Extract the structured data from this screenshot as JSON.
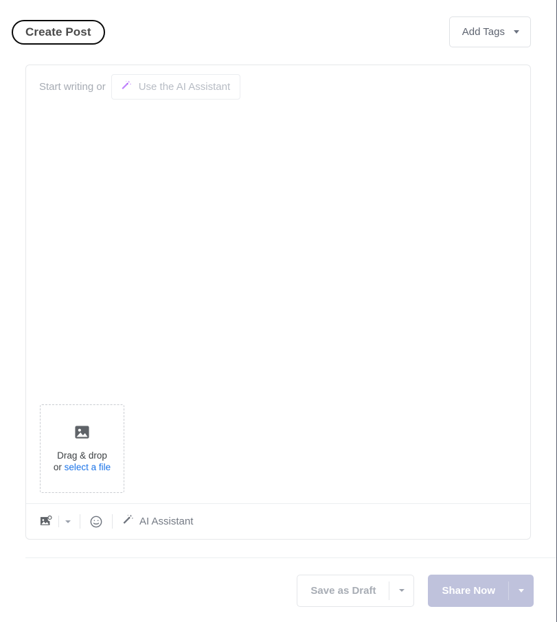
{
  "dialog": {
    "title": "Create Post"
  },
  "header": {
    "add_tags": {
      "label": "Add Tags",
      "icon": "chevron-down-icon"
    }
  },
  "composer": {
    "placeholder_prefix": "Start writing or",
    "ai_pill": {
      "label": "Use the AI Assistant",
      "icon": "magic-wand-icon",
      "icon_color": "#a855f7"
    },
    "dropzone": {
      "icon": "image-icon",
      "line1": "Drag & drop",
      "or_text": "or ",
      "link_text": "select a file",
      "link_color": "#1a73e8"
    }
  },
  "toolbar": {
    "items": [
      {
        "name": "add-image",
        "icon": "image-add-icon"
      },
      {
        "name": "image-options",
        "icon": "chevron-down-icon"
      },
      {
        "name": "emoji",
        "icon": "emoji-smiley-icon"
      },
      {
        "name": "ai-assistant",
        "icon": "magic-wand-icon",
        "label": "AI Assistant"
      }
    ]
  },
  "footer": {
    "save_draft": {
      "label": "Save as Draft",
      "caret_icon": "chevron-down-icon"
    },
    "share_now": {
      "label": "Share Now",
      "caret_icon": "chevron-down-icon",
      "background": "#bfc2dc"
    }
  }
}
